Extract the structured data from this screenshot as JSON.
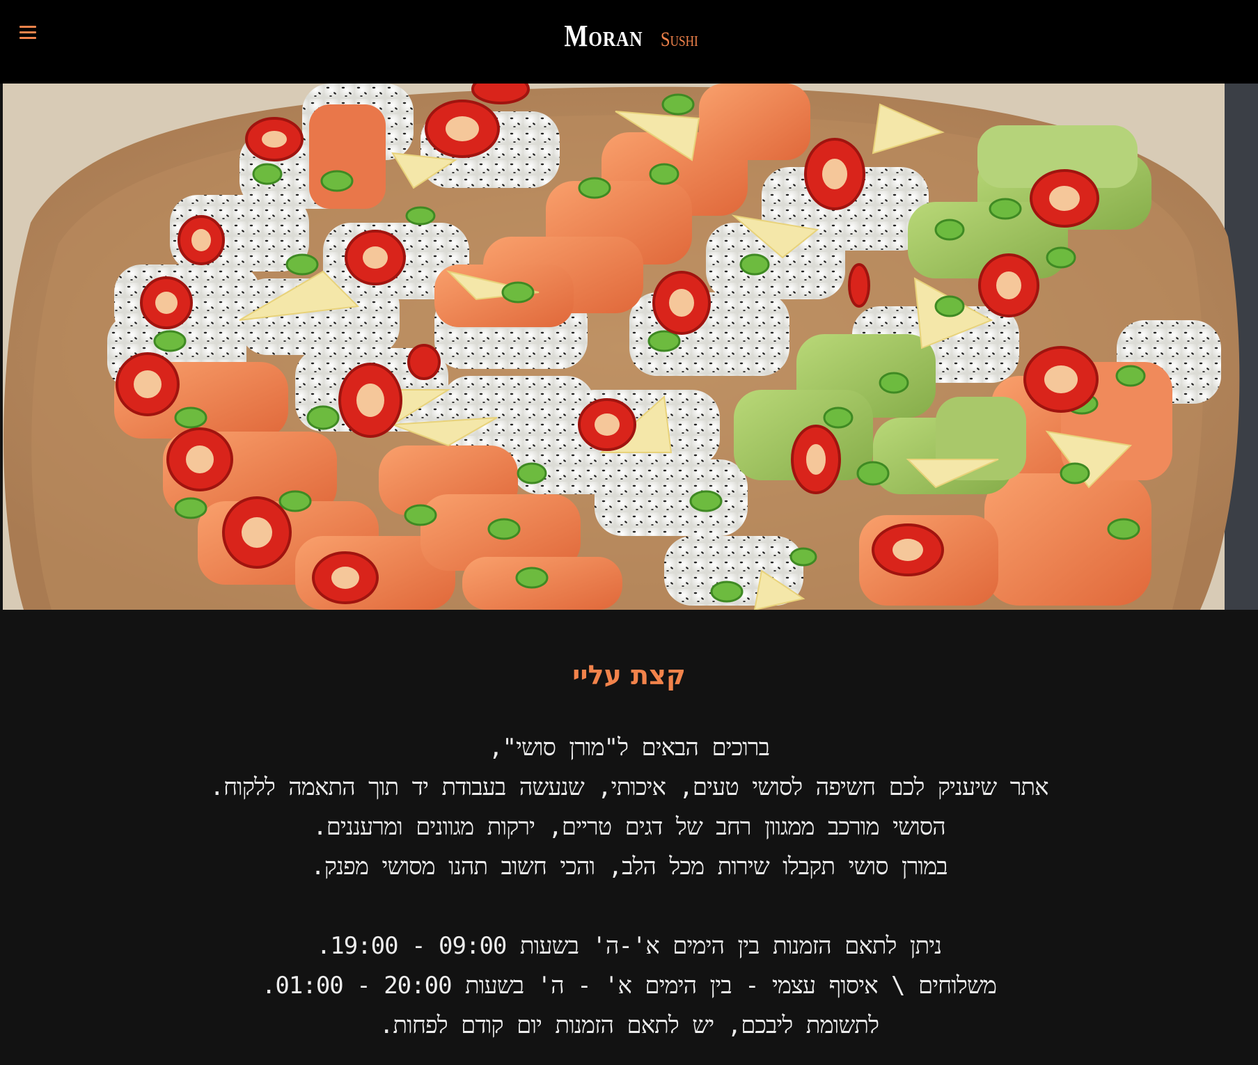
{
  "header": {
    "brand": "Moran",
    "brand_sub": "Sushi",
    "menu_icon": "hamburger-menu-icon",
    "accent_color": "#f2834b",
    "background": "#000000"
  },
  "hero": {
    "image": "sushi-platter-photo"
  },
  "about": {
    "title": "קצת עליי",
    "paragraph1": [
      "ברוכים הבאים ל\"מורן סושי\",",
      "אתר שיעניק לכם חשיפה לסושי טעים, איכותי, שנעשה בעבודת יד תוך התאמה ללקוח.",
      "הסושי מורכב ממגוון רחב של דגים טריים, ירקות מגוונים ומרעננים.",
      "במורן סושי תקבלו שירות מכל הלב, והכי חשוב תהנו מסושי מפנק."
    ],
    "paragraph2": [
      "ניתן לתאם הזמנות בין הימים א'-ה' בשעות 09:00 - 19:00.",
      "משלוחים \\ איסוף עצמי - בין הימים א' - ה' בשעות 20:00 - 01:00.",
      "לתשומת ליבכם, יש לתאם הזמנות יום קודם לפחות."
    ]
  }
}
